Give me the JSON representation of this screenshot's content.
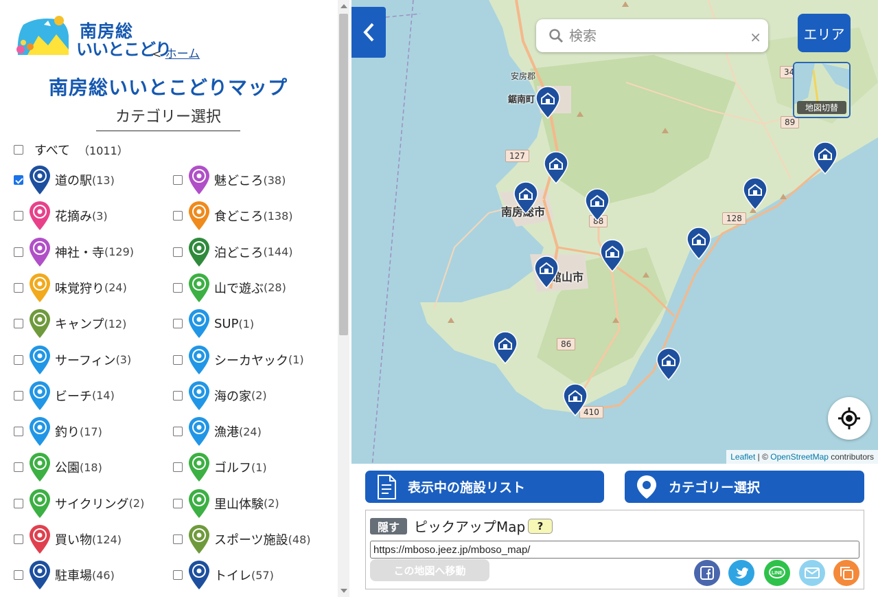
{
  "brand": {
    "line1": "南房総",
    "line2": "いいとこどり",
    "home_sep": "< ",
    "home_link": "ホーム"
  },
  "title": "南房総いいとこどりマップ",
  "category_heading": "カテゴリー選択",
  "all": {
    "label": "すべて",
    "count": "（1011）",
    "checked": false
  },
  "categories": [
    {
      "label": "道の駅",
      "count": "(13)",
      "checked": true,
      "color": "#1d4f9e",
      "icon": "roadside-station-icon"
    },
    {
      "label": "魅どころ",
      "count": "(38)",
      "checked": false,
      "color": "#b04fc8",
      "icon": "eye-icon"
    },
    {
      "label": "花摘み",
      "count": "(3)",
      "checked": false,
      "color": "#e8418a",
      "icon": "flower-icon"
    },
    {
      "label": "食どころ",
      "count": "(138)",
      "checked": false,
      "color": "#ef8a1c",
      "icon": "fork-knife-icon"
    },
    {
      "label": "神社・寺",
      "count": "(129)",
      "checked": false,
      "color": "#b04fc8",
      "icon": "shrine-icon"
    },
    {
      "label": "泊どころ",
      "count": "(144)",
      "checked": false,
      "color": "#2f8a3c",
      "icon": "bed-icon"
    },
    {
      "label": "味覚狩り",
      "count": "(24)",
      "checked": false,
      "color": "#f2a91c",
      "icon": "fruit-picking-icon"
    },
    {
      "label": "山で遊ぶ",
      "count": "(28)",
      "checked": false,
      "color": "#3cb043",
      "icon": "mountain-icon"
    },
    {
      "label": "キャンプ",
      "count": "(12)",
      "checked": false,
      "color": "#6f9a3c",
      "icon": "tent-icon"
    },
    {
      "label": "SUP",
      "count": "(1)",
      "checked": false,
      "color": "#2196e6",
      "icon": "sup-icon"
    },
    {
      "label": "サーフィン",
      "count": "(3)",
      "checked": false,
      "color": "#2196e6",
      "icon": "surfing-icon"
    },
    {
      "label": "シーカヤック",
      "count": "(1)",
      "checked": false,
      "color": "#2196e6",
      "icon": "kayak-icon"
    },
    {
      "label": "ビーチ",
      "count": "(14)",
      "checked": false,
      "color": "#2196e6",
      "icon": "beach-umbrella-icon"
    },
    {
      "label": "海の家",
      "count": "(2)",
      "checked": false,
      "color": "#2196e6",
      "icon": "beach-house-icon"
    },
    {
      "label": "釣り",
      "count": "(17)",
      "checked": false,
      "color": "#2196e6",
      "icon": "fish-icon"
    },
    {
      "label": "漁港",
      "count": "(24)",
      "checked": false,
      "color": "#2196e6",
      "icon": "boat-icon"
    },
    {
      "label": "公園",
      "count": "(18)",
      "checked": false,
      "color": "#3cb043",
      "icon": "tree-icon"
    },
    {
      "label": "ゴルフ",
      "count": "(1)",
      "checked": false,
      "color": "#3cb043",
      "icon": "golf-icon"
    },
    {
      "label": "サイクリング",
      "count": "(2)",
      "checked": false,
      "color": "#3cb043",
      "icon": "bicycle-icon"
    },
    {
      "label": "里山体験",
      "count": "(2)",
      "checked": false,
      "color": "#3cb043",
      "icon": "satoyama-icon"
    },
    {
      "label": "買い物",
      "count": "(124)",
      "checked": false,
      "color": "#e0404e",
      "icon": "basket-icon"
    },
    {
      "label": "スポーツ施設",
      "count": "(48)",
      "checked": false,
      "color": "#6f9a3c",
      "icon": "sports-icon"
    },
    {
      "label": "駐車場",
      "count": "(46)",
      "checked": false,
      "color": "#1d4f9e",
      "icon": "parking-icon"
    },
    {
      "label": "トイレ",
      "count": "(57)",
      "checked": false,
      "color": "#1d4f9e",
      "icon": "toilet-icon"
    }
  ],
  "map": {
    "search_placeholder": "検索",
    "clear": "×",
    "area_button": "エリア",
    "layer_label": "地図切替",
    "labels": [
      "南房総市",
      "館山市",
      "鋸南町",
      "安房郡"
    ],
    "shields": [
      "127",
      "88",
      "128",
      "89",
      "86",
      "410",
      "34"
    ],
    "attribution_leaflet": "Leaflet",
    "attribution_sep": " | © ",
    "attribution_osm": "OpenStreetMap",
    "attribution_tail": " contributors"
  },
  "bottom": {
    "list_button": "表示中の施設リスト",
    "category_button": "カテゴリー選択",
    "hide_button": "隠す",
    "pickup_title": "ピックアップMap",
    "help_button": "?",
    "url": "https://mboso.jeez.jp/mboso_map/",
    "goto_button": "この地図へ移動"
  },
  "colors": {
    "accent": "#1a5fc0",
    "station": "#1d4f9e"
  }
}
